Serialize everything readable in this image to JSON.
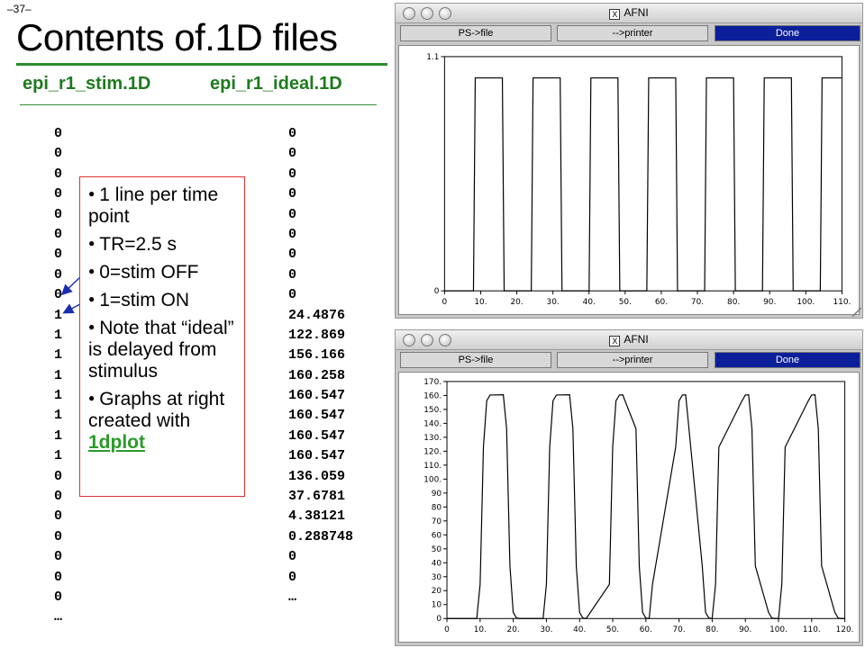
{
  "slide": {
    "page_number": "–37–",
    "title": "Contents of.1D files",
    "stim_file": "epi_r1_stim.1D",
    "ideal_file": "epi_r1_ideal.1D"
  },
  "stim_values": [
    "0",
    "0",
    "0",
    "0",
    "0",
    "0",
    "0",
    "0",
    "0",
    "1",
    "1",
    "1",
    "1",
    "1",
    "1",
    "1",
    "1",
    "0",
    "0",
    "0",
    "0",
    "0",
    "0",
    "0",
    "…"
  ],
  "ideal_values": [
    "0",
    "0",
    "0",
    "0",
    "0",
    "0",
    "0",
    "0",
    "0",
    "24.4876",
    "122.869",
    "156.166",
    "160.258",
    "160.547",
    "160.547",
    "160.547",
    "160.547",
    "136.059",
    "37.6781",
    "4.38121",
    "0.288748",
    "0",
    "0",
    "…"
  ],
  "notes": [
    "1 line per time point",
    "TR=2.5 s",
    "0=stim OFF",
    "1=stim ON",
    "Note that “ideal” is delayed from stimulus",
    "Graphs at right created with"
  ],
  "notes_link": "1dplot",
  "windows": [
    {
      "title": "AFNI",
      "buttons": {
        "ps": "PS->file",
        "printer": "-->printer",
        "done": "Done"
      },
      "colors": {
        "done_bg": "#0b1f9a"
      }
    },
    {
      "title": "AFNI",
      "buttons": {
        "ps": "PS->file",
        "printer": "-->printer",
        "done": "Done"
      }
    }
  ],
  "chart_data": [
    {
      "type": "line",
      "title": "",
      "xlabel": "",
      "ylabel": "",
      "xlim": [
        0,
        110
      ],
      "ylim": [
        0,
        1.1
      ],
      "x_ticks": [
        "0",
        "10.",
        "20.",
        "30.",
        "40.",
        "50.",
        "60.",
        "70.",
        "80.",
        "90.",
        "100.",
        "110."
      ],
      "y_ticks": [
        "0",
        "1.1"
      ],
      "series": [
        {
          "values_x": [
            0,
            8,
            8.5,
            16,
            16.5,
            24,
            24.5,
            32,
            32.5,
            40,
            40.5,
            48,
            48.5,
            56,
            56.5,
            64,
            64.5,
            72,
            72.5,
            80,
            80.5,
            88,
            88.5,
            96,
            96.5,
            104,
            104.5,
            110
          ],
          "values_y": [
            0,
            0,
            1,
            1,
            0,
            0,
            1,
            1,
            0,
            0,
            1,
            1,
            0,
            0,
            1,
            1,
            0,
            0,
            1,
            1,
            0,
            0,
            1,
            1,
            0,
            0,
            1,
            1
          ]
        }
      ]
    },
    {
      "type": "line",
      "title": "",
      "xlabel": "",
      "ylabel": "",
      "xlim": [
        0,
        120
      ],
      "ylim": [
        0,
        170
      ],
      "x_ticks": [
        "0",
        "10.",
        "20.",
        "30.",
        "40.",
        "50.",
        "60.",
        "70.",
        "80.",
        "90.",
        "100.",
        "110.",
        "120."
      ],
      "y_ticks": [
        "0",
        "10",
        "20",
        "30",
        "40",
        "50",
        "60",
        "70",
        "80",
        "90",
        "100.",
        "110.",
        "120.",
        "130.",
        "140.",
        "150.",
        "160.",
        "170."
      ],
      "series": [
        {
          "values_x": [
            0,
            9,
            10,
            11,
            12,
            13,
            17,
            18,
            19,
            20,
            21,
            22,
            29,
            30,
            31,
            32,
            33,
            37,
            38,
            39,
            40,
            41,
            42,
            49,
            50,
            51,
            52,
            53,
            57,
            58,
            59,
            60,
            61,
            62,
            69,
            70,
            71,
            72,
            73,
            77,
            78,
            79,
            80,
            81,
            82,
            89,
            90,
            91,
            92,
            93,
            97,
            98,
            99,
            100,
            101,
            102,
            109,
            110,
            111,
            112,
            113,
            117,
            118,
            119,
            120
          ],
          "values_y": [
            0,
            0,
            24.5,
            122.9,
            156.2,
            160.3,
            160.5,
            136.1,
            37.7,
            4.4,
            0.3,
            0,
            0,
            24.5,
            122.9,
            156.2,
            160.3,
            160.5,
            136.1,
            37.7,
            4.4,
            0.3,
            0,
            24.5,
            122.9,
            156.2,
            160.3,
            160.5,
            136.1,
            37.7,
            4.4,
            0.3,
            0,
            24.5,
            122.9,
            156.2,
            160.3,
            160.5,
            136.1,
            37.7,
            4.4,
            0.3,
            0,
            24.5,
            122.9,
            156.2,
            160.3,
            160.5,
            136.1,
            37.7,
            4.4,
            0.3,
            0,
            0,
            24.5,
            122.9,
            156.2,
            160.3,
            160.5,
            136.1,
            37.7,
            4.4,
            0.3,
            0,
            0
          ]
        }
      ]
    }
  ]
}
